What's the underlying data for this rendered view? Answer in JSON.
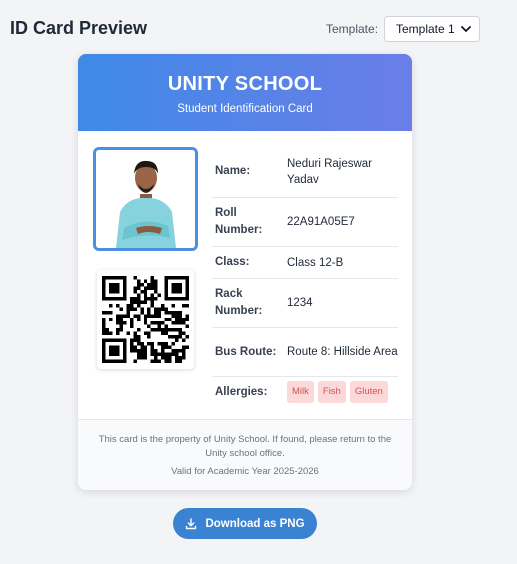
{
  "page": {
    "title": "ID Card Preview"
  },
  "template": {
    "label": "Template:",
    "selected": "Template 1"
  },
  "card": {
    "school_name": "UNITY SCHOOL",
    "subtitle": "Student Identification Card",
    "fields": [
      {
        "key": "Name:",
        "value": "Neduri Rajeswar Yadav"
      },
      {
        "key": "Roll Number:",
        "value": "22A91A05E7"
      },
      {
        "key": "Class:",
        "value": "Class 12-B"
      },
      {
        "key": "Rack Number:",
        "value": "1234"
      },
      {
        "key": "Bus Route:",
        "value": "Route 8: Hillside Area"
      },
      {
        "key": "Allergies:",
        "tags": [
          "Milk",
          "Fish",
          "Gluten"
        ]
      }
    ],
    "footer_text": "This card is the property of Unity School. If found, please return to the Unity school office.",
    "footer_valid": "Valid for Academic Year 2025-2026"
  },
  "download_button": {
    "label": "Download as PNG",
    "icon": "download-icon"
  },
  "colors": {
    "header_gradient_start": "#3f8ae6",
    "header_gradient_end": "#6b7de8",
    "accent": "#3a82d2",
    "tag_bg": "#fdd8d8",
    "tag_text": "#d45353"
  }
}
